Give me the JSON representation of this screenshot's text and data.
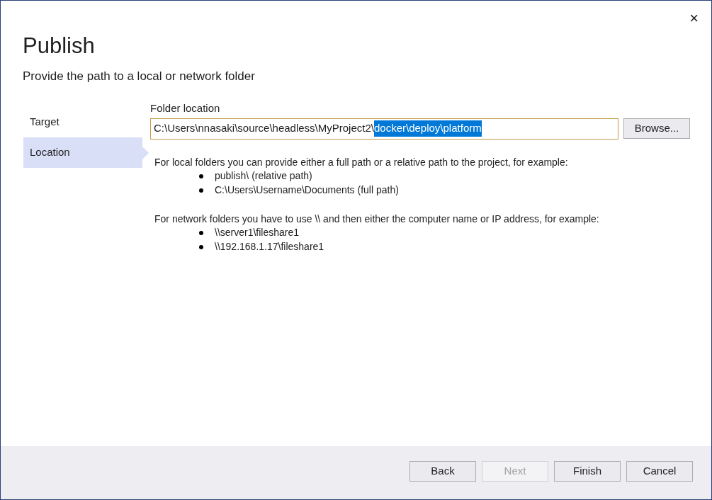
{
  "dialog": {
    "title": "Publish",
    "subtitle": "Provide the path to a local or network folder",
    "close": "×"
  },
  "steps": [
    {
      "label": "Target",
      "selected": false
    },
    {
      "label": "Location",
      "selected": true
    }
  ],
  "folder_location": {
    "label": "Folder location",
    "value_parts": [
      {
        "text": "C:\\Users\\nnasaki\\source\\headless\\MyProject2\\",
        "selected": false
      },
      {
        "text": "docker\\deploy\\platform",
        "selected": true
      }
    ],
    "browse": "Browse..."
  },
  "help": [
    {
      "intro": "For local folders you can provide either a full path or a relative path to the project, for example:",
      "examples": [
        "publish\\ (relative path)",
        "C:\\Users\\Username\\Documents (full path)"
      ]
    },
    {
      "intro": "For network folders you have to use \\\\ and then either the computer name or IP address, for example:",
      "examples": [
        "\\\\server1\\fileshare1",
        "\\\\192.168.1.17\\fileshare1"
      ]
    }
  ],
  "buttons": [
    {
      "label": "Back",
      "disabled": false
    },
    {
      "label": "Next",
      "disabled": true
    },
    {
      "label": "Finish",
      "disabled": false
    },
    {
      "label": "Cancel",
      "disabled": false
    }
  ]
}
